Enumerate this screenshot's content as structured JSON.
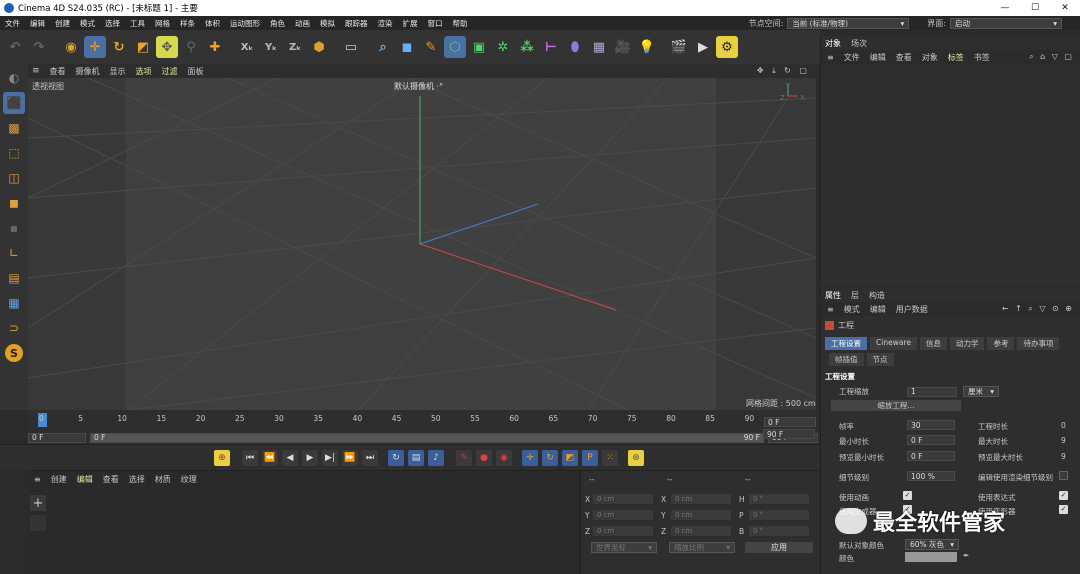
{
  "titlebar": {
    "title": "Cinema 4D S24.035 (RC) - [未标题 1] - 主要",
    "min": "—",
    "max": "☐",
    "close": "✕"
  },
  "menu": {
    "items": [
      "文件",
      "编辑",
      "创建",
      "模式",
      "选择",
      "工具",
      "网格",
      "样条",
      "体积",
      "运动图形",
      "角色",
      "动画",
      "模拟",
      "跟踪器",
      "渲染",
      "扩展",
      "窗口",
      "帮助"
    ],
    "node_space_label": "节点空间:",
    "node_space_value": "当前 (标准/物理)",
    "layout_label": "界面:",
    "layout_value": "启动"
  },
  "viewport": {
    "menu": [
      "查看",
      "摄像机",
      "显示",
      "选项",
      "过滤",
      "面板"
    ],
    "view_label": "透视视图",
    "camera_label": "默认摄像机 ·°",
    "grid_label": "网格间距 : 500 cm",
    "axis_y": "Y",
    "axis_z": "Z",
    "axis_x": "X"
  },
  "objects_panel": {
    "tabs": [
      "对象",
      "场次"
    ],
    "menu": [
      "文件",
      "编辑",
      "查看",
      "对象",
      "标签",
      "书签"
    ]
  },
  "attributes_panel": {
    "tabs": [
      "属性",
      "层",
      "构造"
    ],
    "menu": [
      "模式",
      "编辑",
      "用户数据"
    ],
    "project_label": "工程",
    "subtabs": [
      "工程设置",
      "Cineware",
      "信息",
      "动力学",
      "参考",
      "待办事项"
    ],
    "subtabs2": [
      "帧插值",
      "节点"
    ],
    "section_title": "工程设置",
    "scale_label": "工程缩放",
    "scale_value": "1",
    "scale_unit": "厘米",
    "scale_button": "缩放工程...",
    "fps_label": "帧率",
    "fps_value": "30",
    "project_time_label": "工程时长",
    "project_time_value": "0",
    "min_time_label": "最小时长",
    "min_time_value": "0 F",
    "max_time_label": "最大时长",
    "max_time_value": "9",
    "prev_min_label": "预览最小时长",
    "prev_min_value": "0 F",
    "prev_max_label": "预览最大时长",
    "prev_max_value": "9",
    "lod_label": "细节级别",
    "lod_value": "100 %",
    "render_lod_label": "编辑使用渲染细节级别",
    "use_anim_label": "使用动画",
    "use_expr_label": "使用表达式",
    "use_gen_label": "使用生成器",
    "use_deform_label": "使用变形器",
    "default_color_label": "默认对象颜色",
    "default_color_value": "60% 灰色",
    "color_label": "颜色"
  },
  "timeline": {
    "ticks": [
      "0",
      "5",
      "10",
      "15",
      "20",
      "25",
      "30",
      "35",
      "40",
      "45",
      "50",
      "55",
      "60",
      "65",
      "70",
      "75",
      "80",
      "85",
      "90"
    ],
    "current_frame": "0 F",
    "start": "0 F",
    "range_start": "0 F",
    "range_end": "90 F",
    "end": "90 F",
    "right_top": "0 F",
    "right_bottom": "90 F"
  },
  "materials": {
    "menu": [
      "创建",
      "编辑",
      "查看",
      "选择",
      "材质",
      "纹理"
    ],
    "add": "+"
  },
  "coords": {
    "header1": "--",
    "header2": "--",
    "header3": "--",
    "labels": [
      "X",
      "Y",
      "Z"
    ],
    "labels2": [
      "X",
      "Y",
      "Z"
    ],
    "labels3": [
      "H",
      "P",
      "B"
    ],
    "pos": "0 cm",
    "size": "0 cm",
    "rot": "0 °",
    "world_coord": "世界坐标",
    "scale_ratio": "缩放比例",
    "apply": "应用"
  },
  "watermark": {
    "text": "最全软件管家"
  },
  "colors": {
    "accent": "#4a6fa5",
    "axis_x": "#c94a4a",
    "axis_y": "#4ab36a",
    "axis_z": "#4a7ac9"
  }
}
